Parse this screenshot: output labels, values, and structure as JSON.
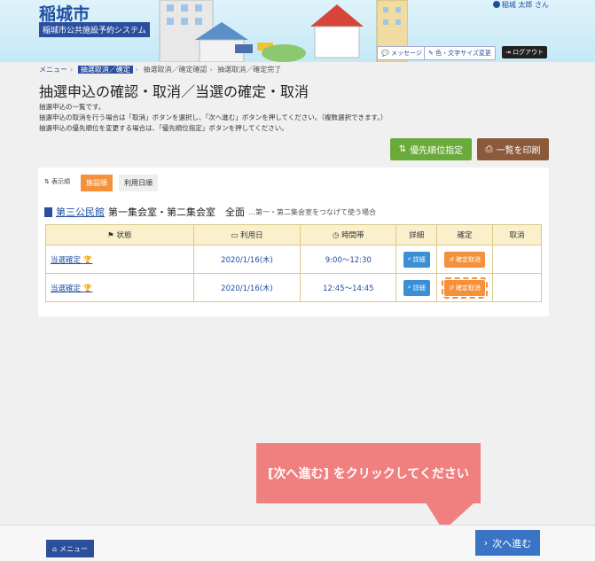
{
  "header": {
    "city": "稲城市",
    "system": "稲城市公共施設予約システム",
    "user": "稲城 太郎 さん",
    "message_btn": "メッセージ",
    "color_btn": "色・文字サイズ変更",
    "logout_btn": "ログアウト"
  },
  "breadcrumb": [
    "メニュー",
    "抽選取消／確定",
    "抽選取消／確定確認",
    "抽選取消／確定完了"
  ],
  "page_title": "抽選申込の確認・取消／当選の確定・取消",
  "desc": [
    "抽選申込の一覧です。",
    "抽選申込の取消を行う場合は「取消」ボタンを選択し、「次へ進む」ボタンを押してください。（複数選択できます。）",
    "抽選申込の優先順位を変更する場合は、「優先順位指定」ボタンを押してください。"
  ],
  "buttons": {
    "priority": "優先順位指定",
    "print": "一覧を印刷",
    "menu": "メニュー",
    "next": "次へ進む"
  },
  "sort": {
    "label": "表示順",
    "tab1": "施設順",
    "tab2": "利用日順"
  },
  "facility": {
    "name": "第三公民館",
    "rooms": "第一集会室・第二集会室　全面",
    "note": "…第一・第二集会室をつなげて使う場合"
  },
  "table": {
    "headers": [
      "状態",
      "利用日",
      "時間帯",
      "詳細",
      "確定",
      "取消"
    ],
    "rows": [
      {
        "status": "当選確定",
        "date": "2020/1/16(木)",
        "time": "9:00〜12:30",
        "detail": "詳細",
        "confirm": "確定取消"
      },
      {
        "status": "当選確定",
        "date": "2020/1/16(木)",
        "time": "12:45〜14:45",
        "detail": "詳細",
        "confirm": "確定取消"
      }
    ]
  },
  "callout": "[次へ進む] をクリックしてください",
  "colors": {
    "primary": "#2b4f9e",
    "accent": "#f4913a",
    "green": "#6aaa3a",
    "brown": "#8a5a3a",
    "callout": "#f08080"
  }
}
